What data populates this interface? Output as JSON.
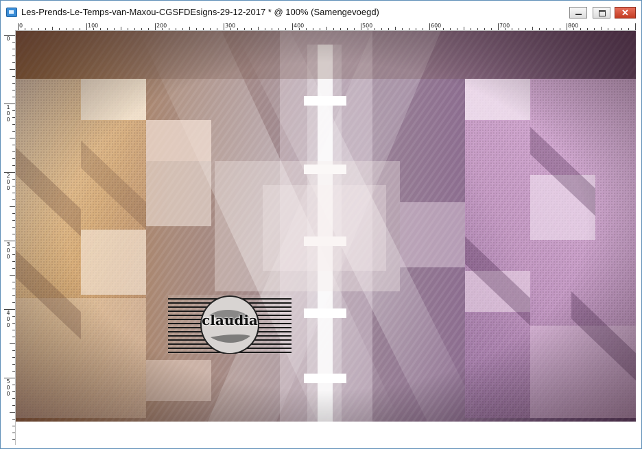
{
  "window": {
    "title": "Les-Prends-Le-Temps-van-Maxou-CGSFDEsigns-29-12-2017 * @ 100% (Samengevoegd)",
    "icon": "app-icon",
    "buttons": {
      "minimize_icon": "minimize-icon",
      "maximize_icon": "maximize-icon",
      "close_label": "✕"
    }
  },
  "ruler": {
    "horizontal_labels": [
      "0",
      "100",
      "200",
      "300",
      "400",
      "500",
      "600",
      "700",
      "800"
    ],
    "vertical_labels": [
      "0",
      "100",
      "200",
      "300",
      "400",
      "500"
    ]
  },
  "canvas": {
    "watermark_text": "claudia",
    "colors": {
      "left_warm": "#e8a24a",
      "mid_mauve": "#9a7a96",
      "right_pink": "#d98ad8",
      "dark_purple": "#4a2a4e"
    }
  }
}
